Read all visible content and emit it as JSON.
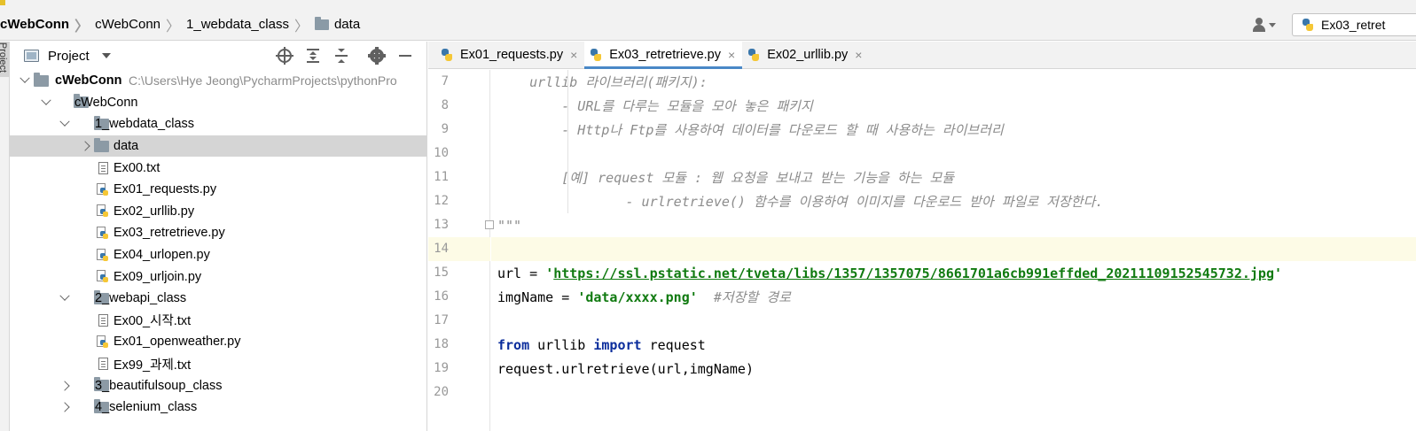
{
  "breadcrumb": {
    "items": [
      {
        "label": "cWebConn",
        "bold": true,
        "folder": false
      },
      {
        "label": "cWebConn",
        "bold": false,
        "folder": false
      },
      {
        "label": "1_webdata_class",
        "bold": false,
        "folder": false
      },
      {
        "label": "data",
        "bold": false,
        "folder": true
      }
    ]
  },
  "run_config": {
    "label": "Ex03_retret"
  },
  "side_strip": {
    "label": "Project"
  },
  "project_panel": {
    "title": "Project",
    "tree": [
      {
        "label": "cWebConn",
        "type": "folder",
        "depth": 0,
        "expanded": true,
        "bold": true,
        "path": "C:\\Users\\Hye Jeong\\PycharmProjects\\pythonPro"
      },
      {
        "label": "cWebConn",
        "type": "folder",
        "depth": 1,
        "expanded": true
      },
      {
        "label": "1_webdata_class",
        "type": "folder",
        "depth": 2,
        "expanded": true
      },
      {
        "label": "data",
        "type": "folder",
        "depth": 3,
        "expanded": false,
        "selected": true
      },
      {
        "label": "Ex00.txt",
        "type": "txt",
        "depth": 3
      },
      {
        "label": "Ex01_requests.py",
        "type": "py",
        "depth": 3
      },
      {
        "label": "Ex02_urllib.py",
        "type": "py",
        "depth": 3
      },
      {
        "label": "Ex03_retretrieve.py",
        "type": "py",
        "depth": 3
      },
      {
        "label": "Ex04_urlopen.py",
        "type": "py",
        "depth": 3
      },
      {
        "label": "Ex09_urljoin.py",
        "type": "py",
        "depth": 3
      },
      {
        "label": "2_webapi_class",
        "type": "folder",
        "depth": 2,
        "expanded": true
      },
      {
        "label": "Ex00_시작.txt",
        "type": "txt",
        "depth": 3
      },
      {
        "label": "Ex01_openweather.py",
        "type": "py",
        "depth": 3
      },
      {
        "label": "Ex99_과제.txt",
        "type": "txt",
        "depth": 3
      },
      {
        "label": "3_beautifulsoup_class",
        "type": "folder",
        "depth": 2,
        "expanded": false
      },
      {
        "label": "4_selenium_class",
        "type": "folder",
        "depth": 2,
        "expanded": false
      }
    ]
  },
  "editor": {
    "tabs": [
      {
        "label": "Ex01_requests.py",
        "active": false
      },
      {
        "label": "Ex03_retretrieve.py",
        "active": true
      },
      {
        "label": "Ex02_urllib.py",
        "active": false
      }
    ],
    "close_glyph": "×",
    "current_line": 14,
    "lines": [
      {
        "n": "7",
        "parts": [
          {
            "t": "    urllib 라이브러리(패키지):",
            "c": "doc-str"
          }
        ]
      },
      {
        "n": "8",
        "parts": [
          {
            "t": "        - URL를 다루는 모듈을 모아 놓은 패키지",
            "c": "doc-str"
          }
        ]
      },
      {
        "n": "9",
        "parts": [
          {
            "t": "        - Http나 Ftp를 사용하여 데이터를 다운로드 할 때 사용하는 라이브러리",
            "c": "doc-str"
          }
        ]
      },
      {
        "n": "10",
        "parts": []
      },
      {
        "n": "11",
        "parts": [
          {
            "t": "        [예] request 모듈 : 웹 요청을 보내고 받는 기능을 하는 모듈",
            "c": "doc-str"
          }
        ]
      },
      {
        "n": "12",
        "parts": [
          {
            "t": "                - urlretrieve() 함수를 이용하여 이미지를 다운로드 받아 파일로 저장한다.",
            "c": "doc-str"
          }
        ]
      },
      {
        "n": "13",
        "parts": [
          {
            "t": "\"\"\"",
            "c": "doc-str"
          }
        ]
      },
      {
        "n": "14",
        "parts": []
      },
      {
        "n": "15",
        "parts": [
          {
            "t": "url = ",
            "c": "plain"
          },
          {
            "t": "'",
            "c": "str"
          },
          {
            "t": "https://ssl.pstatic.net/tveta/libs/1357/1357075/8661701a6cb991effded_20211109152545732.jpg",
            "c": "str url-link"
          },
          {
            "t": "'",
            "c": "str"
          }
        ]
      },
      {
        "n": "16",
        "parts": [
          {
            "t": "imgName = ",
            "c": "plain"
          },
          {
            "t": "'data/xxxx.png'",
            "c": "str"
          },
          {
            "t": "  ",
            "c": "plain"
          },
          {
            "t": "#저장할 경로",
            "c": "cmt"
          }
        ]
      },
      {
        "n": "17",
        "parts": []
      },
      {
        "n": "18",
        "parts": [
          {
            "t": "from",
            "c": "kw"
          },
          {
            "t": " urllib ",
            "c": "plain"
          },
          {
            "t": "import",
            "c": "kw"
          },
          {
            "t": " request",
            "c": "plain"
          }
        ]
      },
      {
        "n": "19",
        "parts": [
          {
            "t": "request.urlretrieve(url,imgName)",
            "c": "plain"
          }
        ]
      },
      {
        "n": "20",
        "parts": []
      }
    ]
  }
}
